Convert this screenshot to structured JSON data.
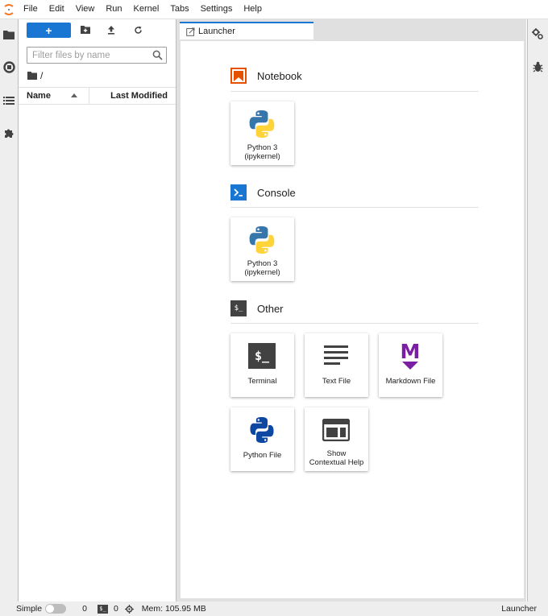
{
  "menubar": {
    "items": [
      "File",
      "Edit",
      "View",
      "Run",
      "Kernel",
      "Tabs",
      "Settings",
      "Help"
    ],
    "logo_icon": "jupyter-logo"
  },
  "leftbar": {
    "icons": [
      "folder-icon",
      "running-icon",
      "toc-icon",
      "extension-icon"
    ]
  },
  "filebrowser": {
    "new_button_label": "+",
    "filter_placeholder": "Filter files by name",
    "breadcrumb_path": "/",
    "columns": {
      "name": "Name",
      "last_modified": "Last Modified"
    }
  },
  "tabs": [
    {
      "label": "Launcher"
    }
  ],
  "launcher": {
    "sections": [
      {
        "title": "Notebook",
        "icon": "notebook-icon",
        "items": [
          {
            "label": "Python 3\n(ipykernel)",
            "icon": "python-icon"
          }
        ]
      },
      {
        "title": "Console",
        "icon": "console-icon",
        "items": [
          {
            "label": "Python 3\n(ipykernel)",
            "icon": "python-icon"
          }
        ]
      },
      {
        "title": "Other",
        "icon": "other-icon",
        "other_icon_text": "$_",
        "items": [
          {
            "label": "Terminal",
            "icon": "terminal-icon",
            "icon_text": "$_"
          },
          {
            "label": "Text File",
            "icon": "text-file-icon"
          },
          {
            "label": "Markdown File",
            "icon": "markdown-icon",
            "icon_text": "M"
          },
          {
            "label": "Python File",
            "icon": "python-file-icon"
          },
          {
            "label": "Show\nContextual Help",
            "icon": "contextual-help-icon"
          }
        ]
      }
    ]
  },
  "statusbar": {
    "mode_label": "Simple",
    "kernels_count": "0",
    "terminal_icon_text": "$_",
    "terminals_count": "0",
    "memory": "Mem: 105.95 MB",
    "active_tab": "Launcher"
  },
  "colors": {
    "accent": "#1976d2",
    "notebook_orange": "#e65100",
    "console_blue": "#1976d2",
    "markdown_purple": "#7b1fa2",
    "dark_icon": "#424242"
  }
}
